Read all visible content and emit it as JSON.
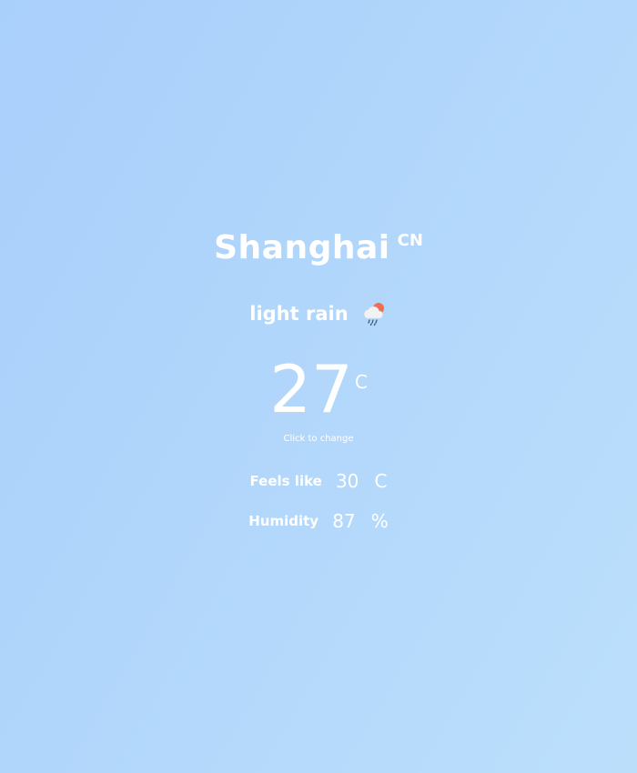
{
  "location": {
    "city": "Shanghai",
    "country": "CN"
  },
  "weather": {
    "condition": "light rain",
    "icon": "rain-cloud-sun-icon",
    "temperature": "27",
    "temperature_unit": "C",
    "toggle_hint": "Click to change"
  },
  "details": {
    "feels_like": {
      "label": "Feels like",
      "value": "30",
      "unit": "C"
    },
    "humidity": {
      "label": "Humidity",
      "value": "87",
      "unit": "%"
    }
  },
  "colors": {
    "background_start": "#a9cffb",
    "background_end": "#bbdffb",
    "text": "#ffffff"
  }
}
